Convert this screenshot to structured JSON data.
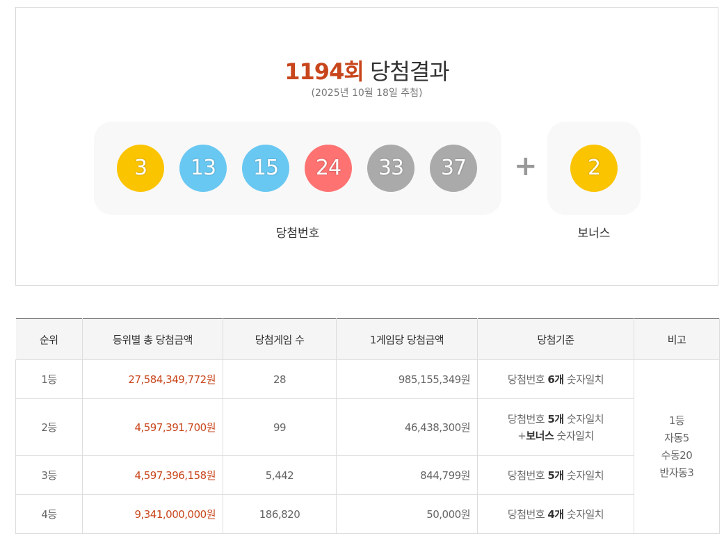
{
  "header": {
    "round": "1194회",
    "title_suffix": " 당첨결과",
    "draw_date": "(2025년 10월 18일 추첨)"
  },
  "winning": {
    "balls": [
      {
        "number": "3",
        "color": "#fbc400"
      },
      {
        "number": "13",
        "color": "#69c8f2"
      },
      {
        "number": "15",
        "color": "#69c8f2"
      },
      {
        "number": "24",
        "color": "#ff7272"
      },
      {
        "number": "33",
        "color": "#aaaaaa"
      },
      {
        "number": "37",
        "color": "#aaaaaa"
      }
    ],
    "label": "당첨번호",
    "plus": "+",
    "bonus": {
      "number": "2",
      "color": "#fbc400"
    },
    "bonus_label": "보너스"
  },
  "table": {
    "headers": [
      "순위",
      "등위별 총 당첨금액",
      "당첨게임 수",
      "1게임당 당첨금액",
      "당첨기준",
      "비고"
    ],
    "rows": [
      {
        "rank": "1등",
        "total": "27,584,349,772원",
        "winners": "28",
        "per_game": "985,155,349원",
        "crit_pre": "당첨번호 ",
        "crit_bold": "6개",
        "crit_post": " 숫자일치",
        "crit2_pre": "",
        "crit2_bold": "",
        "crit2_post": ""
      },
      {
        "rank": "2등",
        "total": "4,597,391,700원",
        "winners": "99",
        "per_game": "46,438,300원",
        "crit_pre": "당첨번호 ",
        "crit_bold": "5개",
        "crit_post": " 숫자일치",
        "crit2_pre": "+",
        "crit2_bold": "보너스",
        "crit2_post": " 숫자일치"
      },
      {
        "rank": "3등",
        "total": "4,597,396,158원",
        "winners": "5,442",
        "per_game": "844,799원",
        "crit_pre": "당첨번호 ",
        "crit_bold": "5개",
        "crit_post": " 숫자일치",
        "crit2_pre": "",
        "crit2_bold": "",
        "crit2_post": ""
      },
      {
        "rank": "4등",
        "total": "9,341,000,000원",
        "winners": "186,820",
        "per_game": "50,000원",
        "crit_pre": "당첨번호 ",
        "crit_bold": "4개",
        "crit_post": " 숫자일치",
        "crit2_pre": "",
        "crit2_bold": "",
        "crit2_post": ""
      }
    ],
    "note_lines": [
      "1등",
      "자동5",
      "수동20",
      "반자동3"
    ]
  }
}
